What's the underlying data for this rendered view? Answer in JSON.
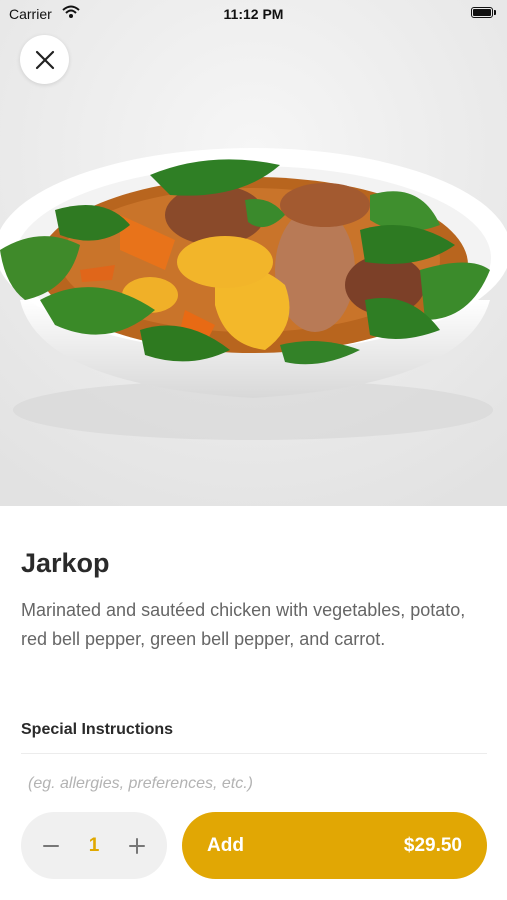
{
  "status_bar": {
    "carrier": "Carrier",
    "time": "11:12 PM"
  },
  "hero": {
    "image_subject": "bowl of chicken stew with potatoes, carrots and spinach",
    "close_icon": "close-icon"
  },
  "dish": {
    "title": "Jarkop",
    "description": "Marinated and sautéed chicken with vegetables, potato, red bell pepper, green bell pepper, and carrot."
  },
  "special_instructions": {
    "label": "Special Instructions",
    "placeholder": "(eg. allergies, preferences, etc.)",
    "value": ""
  },
  "order": {
    "minus_icon": "minus-icon",
    "plus_icon": "plus-icon",
    "quantity": "1",
    "add_label": "Add",
    "price": "$29.50"
  },
  "colors": {
    "accent": "#e1a704",
    "quantity_text": "#e0a800",
    "stepper_bg": "#f0f0f0",
    "title_text": "#2a2a2a",
    "description_text": "#666666"
  }
}
